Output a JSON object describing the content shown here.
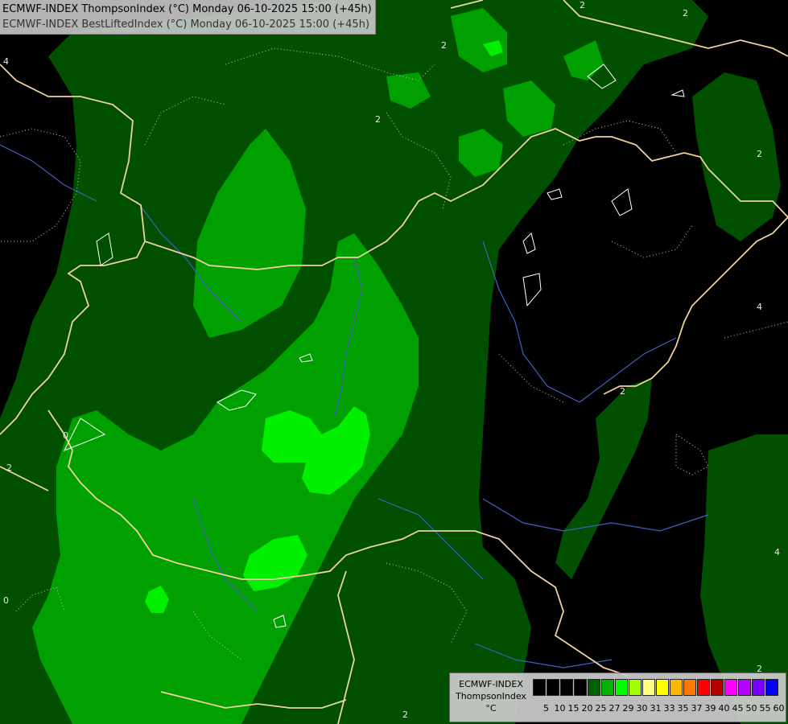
{
  "header": {
    "line1": "ECMWF-INDEX ThompsonIndex (°C) Monday 06-10-2025 15:00 (+45h)",
    "line2": "ECMWF-INDEX BestLiftedIndex (°C) Monday 06-10-2025 15:00 (+45h)"
  },
  "legend": {
    "model": "ECMWF-INDEX",
    "parameter": "ThompsonIndex",
    "unit": "°C",
    "ticks": [
      "5",
      "10",
      "15",
      "20",
      "25",
      "27",
      "29",
      "30",
      "31",
      "33",
      "35",
      "37",
      "39",
      "40",
      "45",
      "50",
      "55",
      "60"
    ],
    "colors": [
      "#000000",
      "#000000",
      "#000000",
      "#000000",
      "#005f00",
      "#00b400",
      "#00ff00",
      "#a0ff00",
      "#ffff80",
      "#ffff00",
      "#ffb400",
      "#ff7800",
      "#ff0000",
      "#b40000",
      "#ff00ff",
      "#b400ff",
      "#7800ff",
      "#0000ff"
    ]
  },
  "contour_labels": [
    "2",
    "2",
    "2",
    "2",
    "2",
    "2",
    "2",
    "4",
    "4",
    "4",
    "0",
    "0",
    "2",
    "2"
  ],
  "fill_colors": {
    "dark_green": "#005000",
    "mid_green": "#00a000",
    "bright_green": "#00f000",
    "background": "#000000",
    "border": "#f0d0a0",
    "river": "#4060c0"
  }
}
